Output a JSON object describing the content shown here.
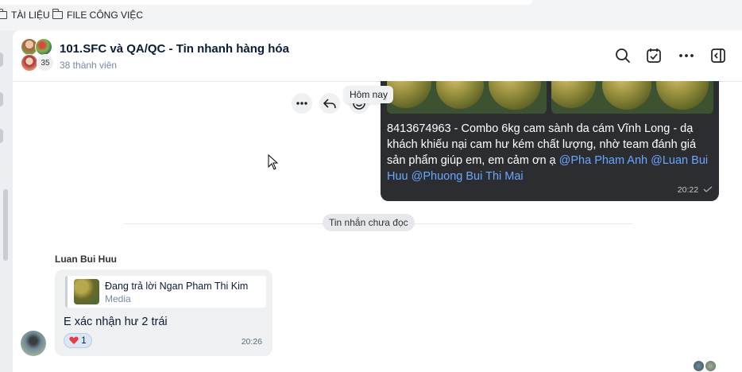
{
  "bookmarks": [
    {
      "label": "TÀI LIỆU",
      "icon": "folder-icon"
    },
    {
      "label": "FILE CÔNG VIỆC",
      "icon": "folder-icon"
    }
  ],
  "header": {
    "title": "101.SFC và QA/QC - Tin nhanh hàng hóa",
    "subtitle": "38 thành viên",
    "avatar_extra_count": "35",
    "actions": [
      "search-icon",
      "task-icon",
      "more-icon",
      "sidebar-toggle-icon"
    ]
  },
  "outgoing_message": {
    "text": "8413674963 -  Combo 6kg cam sành da cám Vĩnh Long - dạ khách khiếu nại cam hư kém chất lượng, nhờ team đánh giá sản phẩm giúp em, em cảm ơn ạ ",
    "mentions": [
      "@Pha Pham Anh",
      "@Luan Bui Huu",
      "@Phuong Bui Thi Mai"
    ],
    "time": "20:22"
  },
  "message_actions": [
    "more-icon",
    "reply-icon",
    "reaction-icon"
  ],
  "tooltip": "Hôm nay",
  "unread_divider": "Tin nhắn chưa đọc",
  "incoming_message": {
    "sender": "Luan Bui Huu",
    "reply_to": "Đang trả lời Ngan Pham Thi Kim",
    "reply_type": "Media",
    "text": "E xác nhận hư 2 trái",
    "reaction_count": "1",
    "time": "20:26"
  },
  "colors": {
    "accent": "#0068ff",
    "mention": "#6aa7ff",
    "outgoing_bubble": "#2b2d31",
    "incoming_bubble": "#eef0f2"
  }
}
